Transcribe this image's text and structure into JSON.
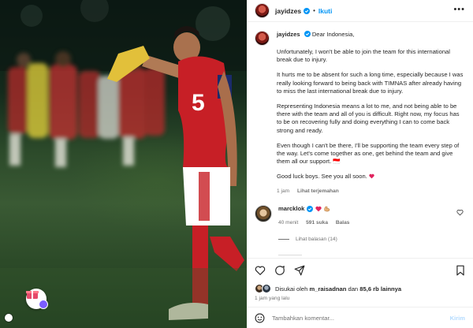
{
  "post": {
    "author": "jayidzes",
    "follow_label": "Ikuti",
    "separator": "•",
    "more_icon": "more-horizontal-icon"
  },
  "caption": {
    "author": "jayidzes",
    "greeting": "Dear Indonesia,",
    "paragraphs": [
      "Unfortunately, I won't be able to join the team for this international break due to injury.",
      "It hurts me to be absent for such a long time, especially because I was really looking forward to being back with TIMNAS after already having to miss the last international break due to injury.",
      "Representing Indonesia means a lot to me, and not being able to be there with the team and all of you is difficult. Right now, my focus has to be on recovering fully and doing everything I can to come back strong and ready.",
      "Even though I can't be there, I'll be supporting the team every step of the way. Let's come together as one, get behind the team and give them all our support. 🇮🇩",
      "Good luck boys. See you all soon."
    ],
    "time": "1 jam",
    "translate_label": "Lihat terjemahan"
  },
  "top_comment": {
    "author": "marcklok",
    "time": "40 menit",
    "likes": "591 suka",
    "reply_label": "Balas",
    "view_replies": "Lihat balasan (14)"
  },
  "engagement": {
    "liked_by_prefix": "Disukai oleh",
    "liked_by_user": "m_raisadnan",
    "liked_by_suffix": "dan",
    "others": "85,6 rb lainnya",
    "time_ago": "1 jam yang lalu"
  },
  "comment_input": {
    "placeholder": "Tambahkan komentar...",
    "send_label": "Kirim"
  },
  "colors": {
    "accent": "#0095f6",
    "heart": "#ed4956",
    "verified": "#0095f6"
  }
}
